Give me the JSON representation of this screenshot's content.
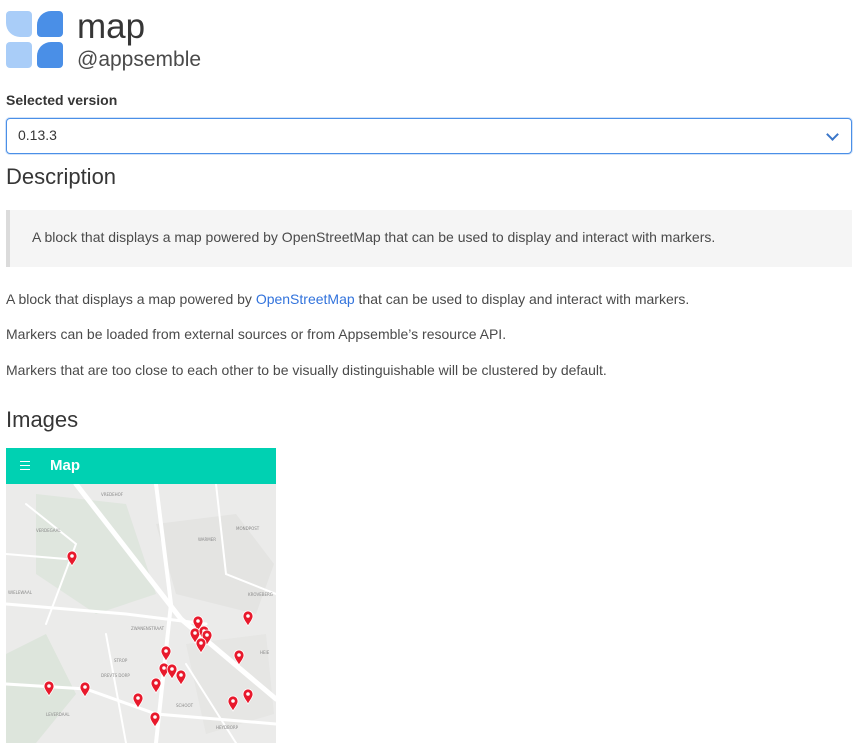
{
  "header": {
    "title": "map",
    "subtitle": "@appsemble"
  },
  "version": {
    "label": "Selected version",
    "selected": "0.13.3"
  },
  "description": {
    "heading": "Description",
    "quote": "A block that displays a map powered by OpenStreetMap that can be used to display and interact with markers.",
    "paragraph1_before": "A block that displays a map powered by ",
    "paragraph1_link": "OpenStreetMap",
    "paragraph1_after": " that can be used to display and interact with markers.",
    "paragraph2": "Markers can be loaded from external sources or from Appsemble’s resource API.",
    "paragraph3": "Markers that are too close to each other to be visually distinguishable will be clustered by default."
  },
  "images": {
    "heading": "Images",
    "screenshot": {
      "app_title": "Map",
      "navbar_color": "#00d1b2",
      "marker_color": "#e8192c",
      "map_labels": [
        "VREDEHOF",
        "VERDEGAAL",
        "MONDPOST",
        "WIELEWAAL",
        "KROVEBERG",
        "ZWANENSTRAAT",
        "STROP",
        "DREVTS DORP",
        "SCHOOT",
        "LEVERDAAL",
        "HEYDBORP",
        "HEIE",
        "WARMER"
      ]
    }
  },
  "colors": {
    "accent": "#4a8fe7",
    "link": "#3273dc"
  }
}
